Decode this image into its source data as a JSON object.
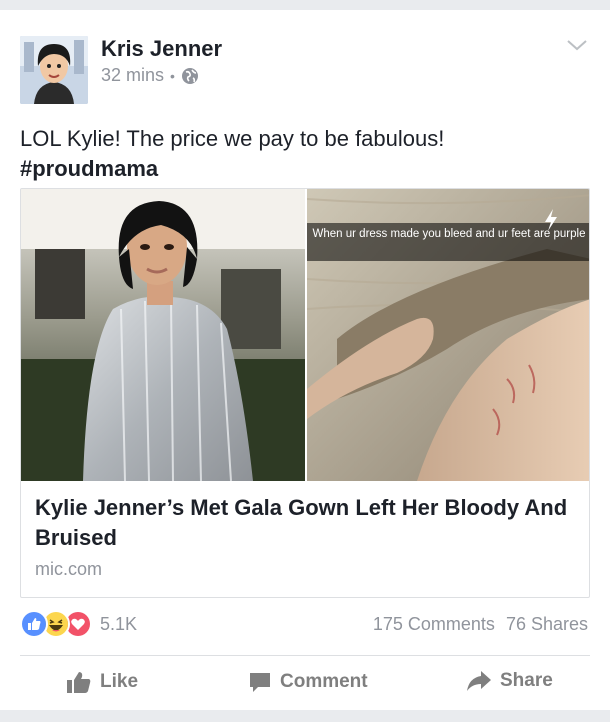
{
  "post": {
    "author": "Kris Jenner",
    "time": "32 mins",
    "separator": "•",
    "privacy_icon": "globe-icon",
    "menu_icon": "chevron-down-icon",
    "text": "LOL Kylie! The price we pay to be fabulous!",
    "hashtag": "#proudmama"
  },
  "link_preview": {
    "snap_caption": "When ur dress made you bleed and ur feet are purple",
    "title": "Kylie Jenner’s Met Gala Gown Left Her Bloody And Bruised",
    "domain": "mic.com"
  },
  "reactions": {
    "icons": [
      "like-icon",
      "haha-icon",
      "love-icon"
    ],
    "count": "5.1K",
    "comments": "175 Comments",
    "shares": "76 Shares"
  },
  "actions": {
    "like": "Like",
    "comment": "Comment",
    "share": "Share"
  },
  "colors": {
    "facebook_blue": "#5890ff",
    "love_red": "#f25268",
    "haha_yellow": "#fcd64e",
    "muted_text": "#90949c"
  }
}
